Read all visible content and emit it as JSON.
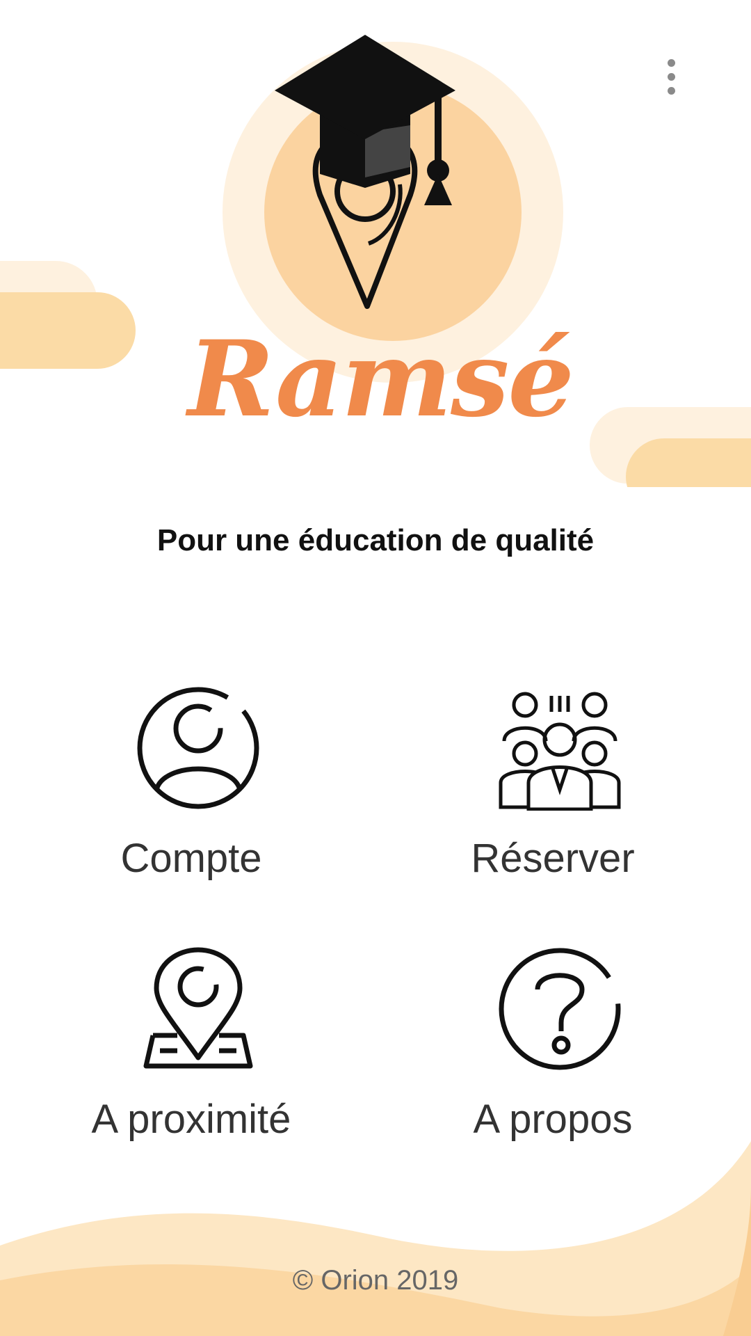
{
  "app": {
    "brand": "Ramsé",
    "tagline": "Pour une éducation de qualité"
  },
  "menu": {
    "icon": "more-vert-icon"
  },
  "tiles": [
    {
      "label": "Compte",
      "icon": "user-icon"
    },
    {
      "label": "Réserver",
      "icon": "group-icon"
    },
    {
      "label": "A proximité",
      "icon": "location-map-icon"
    },
    {
      "label": "A propos",
      "icon": "help-icon"
    }
  ],
  "footer": {
    "copyright": "© Orion 2019"
  },
  "colors": {
    "accent": "#f08a4b",
    "peach": "#fbd7a5",
    "peach_light": "#fef1df",
    "text": "#333333"
  }
}
